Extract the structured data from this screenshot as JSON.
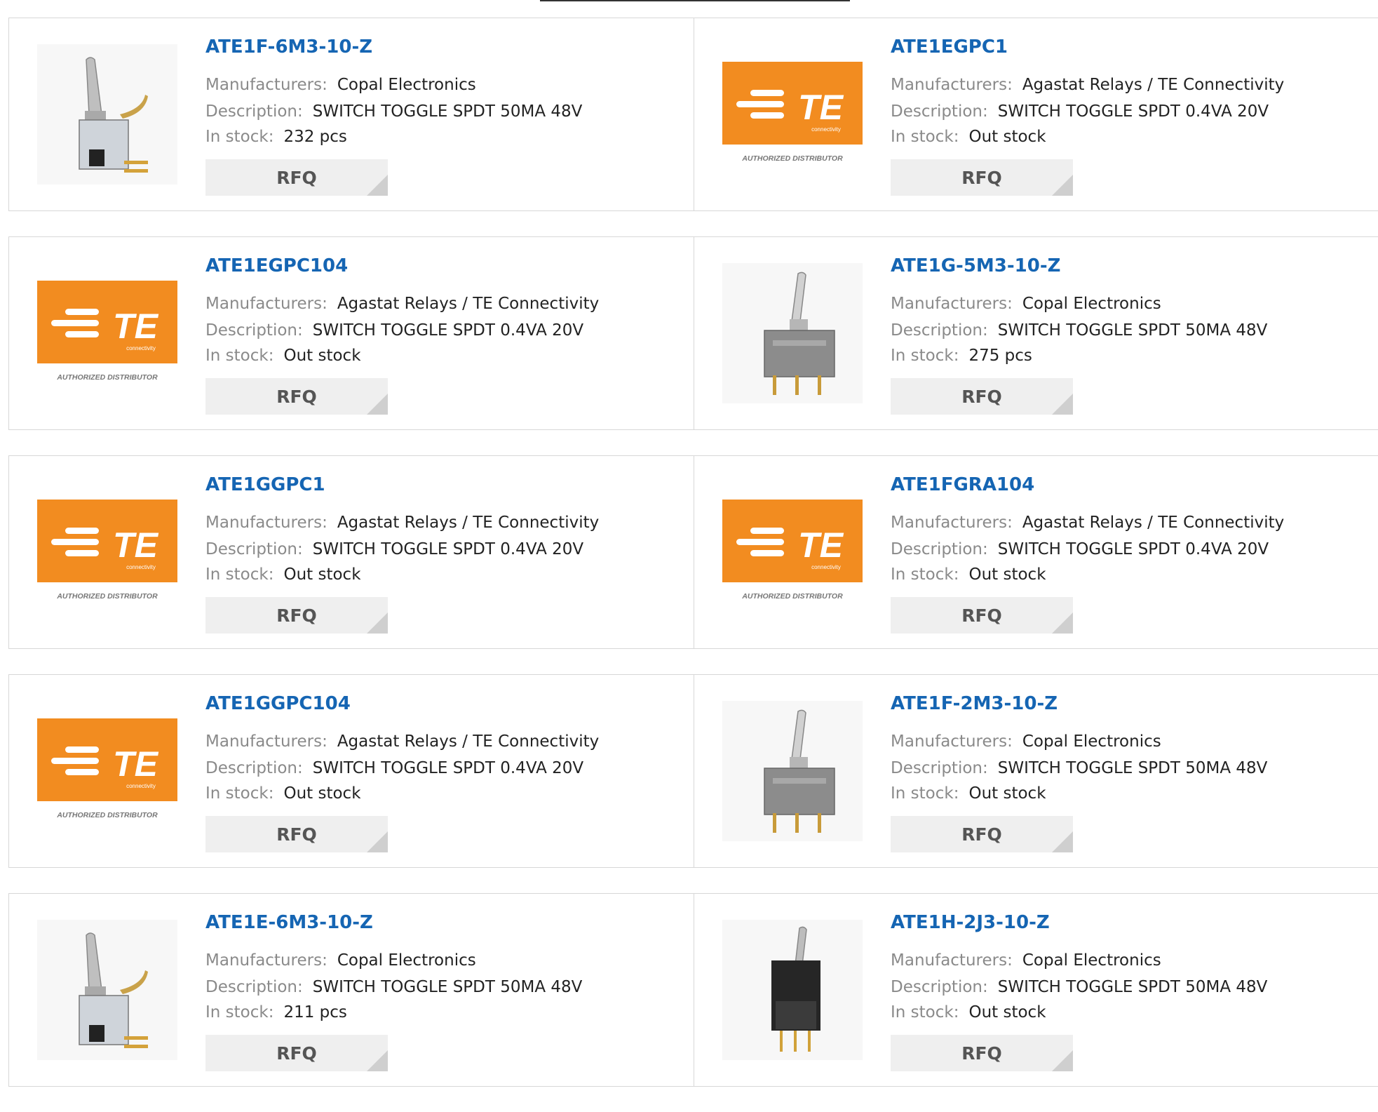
{
  "labels": {
    "manufacturers": "Manufacturers:",
    "description": "Description:",
    "stock": "In stock:",
    "rfq": "RFQ"
  },
  "te_logo": {
    "mark": "TE",
    "sub": "connectivity",
    "caption": "AUTHORIZED DISTRIBUTOR",
    "color": "#f28c20"
  },
  "colors": {
    "title": "#1565b3",
    "label": "#8a8a8a",
    "button_bg": "#efefef"
  },
  "products": [
    {
      "part": "ATE1F-6M3-10-Z",
      "manufacturer": "Copal Electronics",
      "description": "SWITCH TOGGLE SPDT 50MA 48V",
      "stock": "232 pcs",
      "image": "toggle-switch-angled-icon"
    },
    {
      "part": "ATE1EGPC1",
      "manufacturer": "Agastat Relays / TE Connectivity",
      "description": "SWITCH TOGGLE SPDT 0.4VA 20V",
      "stock": "Out stock",
      "image": "te-logo"
    },
    {
      "part": "ATE1EGPC104",
      "manufacturer": "Agastat Relays / TE Connectivity",
      "description": "SWITCH TOGGLE SPDT 0.4VA 20V",
      "stock": "Out stock",
      "image": "te-logo"
    },
    {
      "part": "ATE1G-5M3-10-Z",
      "manufacturer": "Copal Electronics",
      "description": "SWITCH TOGGLE SPDT 50MA 48V",
      "stock": "275 pcs",
      "image": "toggle-switch-gray-icon"
    },
    {
      "part": "ATE1GGPC1",
      "manufacturer": "Agastat Relays / TE Connectivity",
      "description": "SWITCH TOGGLE SPDT 0.4VA 20V",
      "stock": "Out stock",
      "image": "te-logo"
    },
    {
      "part": "ATE1FGRA104",
      "manufacturer": "Agastat Relays / TE Connectivity",
      "description": "SWITCH TOGGLE SPDT 0.4VA 20V",
      "stock": "Out stock",
      "image": "te-logo"
    },
    {
      "part": "ATE1GGPC104",
      "manufacturer": "Agastat Relays / TE Connectivity",
      "description": "SWITCH TOGGLE SPDT 0.4VA 20V",
      "stock": "Out stock",
      "image": "te-logo"
    },
    {
      "part": "ATE1F-2M3-10-Z",
      "manufacturer": "Copal Electronics",
      "description": "SWITCH TOGGLE SPDT 50MA 48V",
      "stock": "Out stock",
      "image": "toggle-switch-gray-icon"
    },
    {
      "part": "ATE1E-6M3-10-Z",
      "manufacturer": "Copal Electronics",
      "description": "SWITCH TOGGLE SPDT 50MA 48V",
      "stock": "211 pcs",
      "image": "toggle-switch-angled-icon"
    },
    {
      "part": "ATE1H-2J3-10-Z",
      "manufacturer": "Copal Electronics",
      "description": "SWITCH TOGGLE SPDT 50MA 48V",
      "stock": "Out stock",
      "image": "toggle-switch-black-icon"
    }
  ]
}
